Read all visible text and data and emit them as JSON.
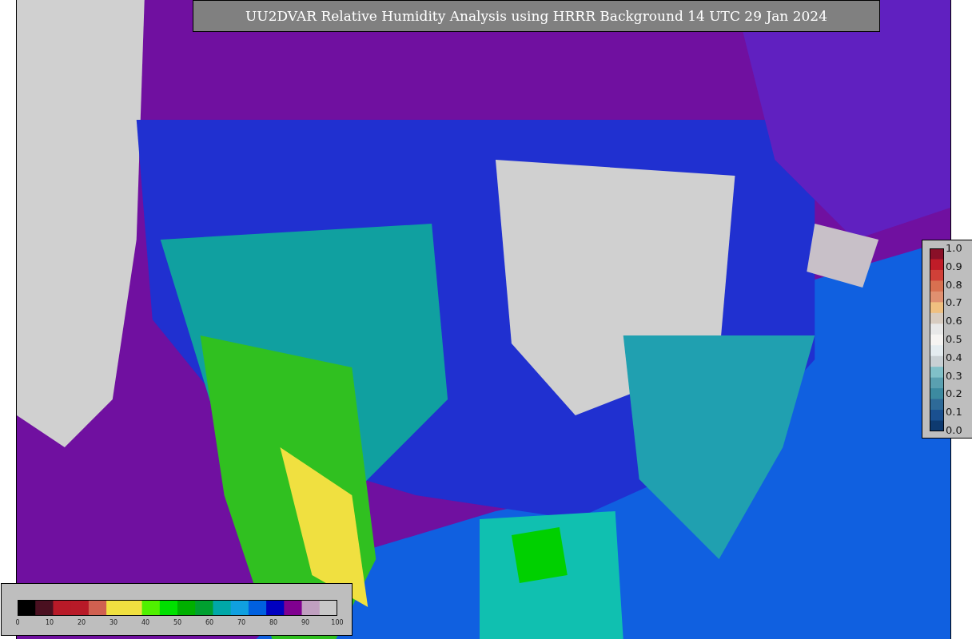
{
  "title": "UU2DVAR Relative Humidity Analysis using HRRR Background 14 UTC 29 Jan 2024",
  "humidity_colorbar": {
    "ticks": [
      "0",
      "10",
      "20",
      "30",
      "40",
      "50",
      "60",
      "70",
      "80",
      "90",
      "100"
    ]
  },
  "observation_colorbar": {
    "ticks": [
      "1.0",
      "0.9",
      "0.8",
      "0.7",
      "0.6",
      "0.5",
      "0.4",
      "0.3",
      "0.2",
      "0.1",
      "0.0"
    ]
  }
}
